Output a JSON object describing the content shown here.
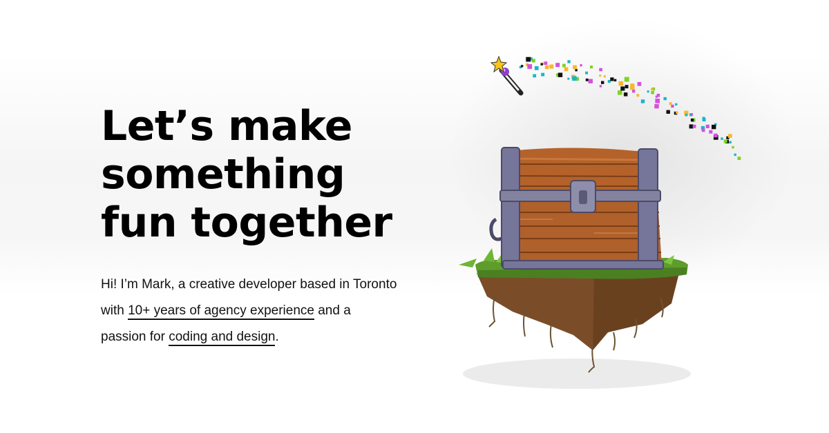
{
  "hero": {
    "headline_lines": [
      "Let’s make",
      "something",
      "fun together"
    ],
    "intro": {
      "part1": "Hi! I’m Mark, a creative developer based in Toronto with ",
      "link1": "10+ years of agency experience",
      "part2": " and a passion for ",
      "link2": "coding and design",
      "part3": "."
    }
  },
  "illustration": {
    "subject": "floating-island-treasure-chest",
    "wand": "magic-wand-icon",
    "sparkle_colors": [
      "#d451e0",
      "#19b6c9",
      "#7ed321",
      "#f5b82e",
      "#111111"
    ],
    "wood_color": "#b4622a",
    "metal_color": "#76759a",
    "grass_color": "#5e9c2c",
    "dirt_color": "#7a4d28"
  }
}
